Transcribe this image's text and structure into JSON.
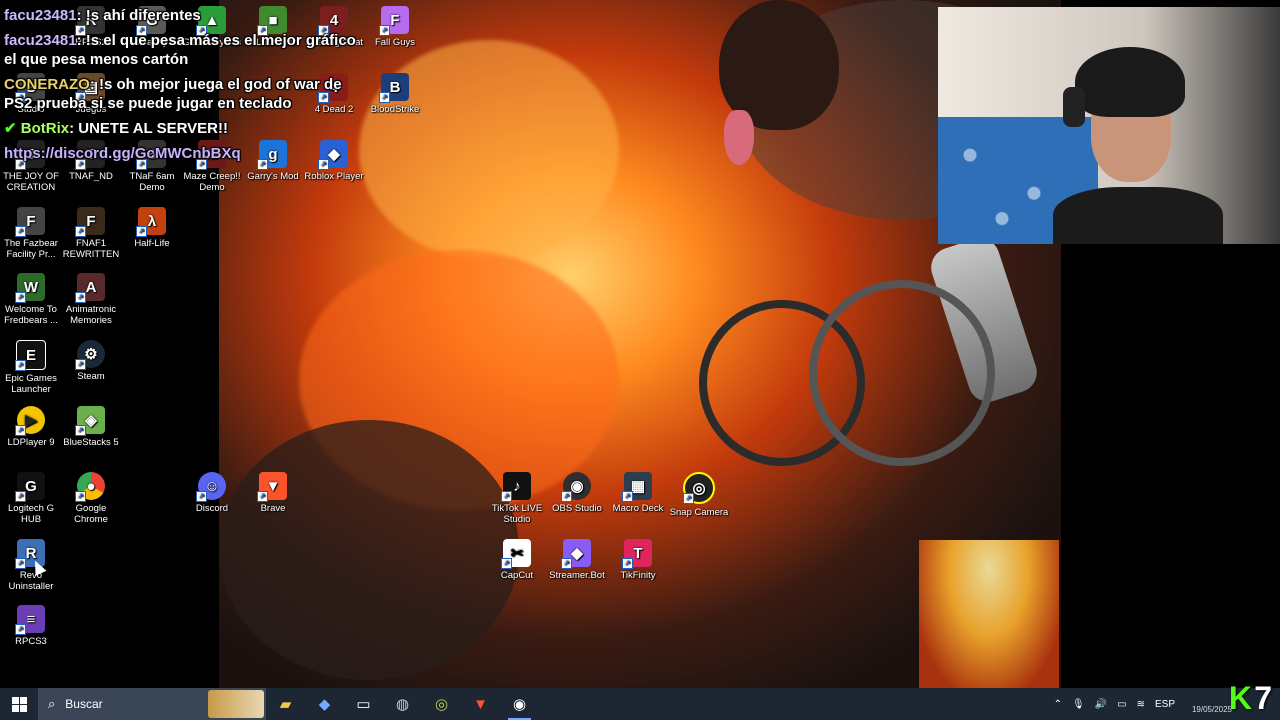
{
  "chat": [
    {
      "user": "facu23481",
      "text": ": !s ahí diferentes"
    },
    {
      "user": "facu23481",
      "text": ": !s el que pesa más es el mejor gráfico el que pesa menos cartón"
    },
    {
      "user": "CONERAZO",
      "text": ": !s oh mejor juega el god of war de PS2 prueba si se puede jugar en teclado"
    },
    {
      "user": "BotRix",
      "text": ": UNETE AL SERVER!!"
    },
    {
      "link": "https://discord.gg/GcMWCnbBXq"
    }
  ],
  "icons": {
    "rpcs2": "RPCS2",
    "granny": "Granny",
    "geometry": "GeometryDas",
    "tlauncher": "TLauncher",
    "fivenights": "Five Nights at",
    "fallguys": "Fall Guys",
    "studio": "Studio",
    "juegos": "Juegos",
    "left4dead": "4 Dead 2",
    "bloodstrike": "BloodStrike",
    "joy": "THE JOY OF CREATION",
    "tnafnd": "TNAF_ND",
    "tnaf6am": "TNaF 6am Demo",
    "mazecreep": "Maze Creep!! Demo",
    "garrys": "Garry's Mod",
    "roblox": "Roblox Player",
    "fazbear": "The Fazbear Facility Pr...",
    "fnaf1": "FNAF1 REWRITTEN",
    "halflife": "Half-Life",
    "welcome": "Welcome To Fredbears ...",
    "animatronic": "Animatronic Memories",
    "epic": "Epic Games Launcher",
    "steam": "Steam",
    "ldplayer": "LDPlayer 9",
    "bluestacks": "BlueStacks 5",
    "logitech": "Logitech G HUB",
    "chrome": "Google Chrome",
    "discord": "Discord",
    "brave": "Brave",
    "tiktok": "TikTok LIVE Studio",
    "obs": "OBS Studio",
    "macrodeck": "Macro Deck",
    "snapcam": "Snap Camera",
    "revo": "Revo Uninstaller",
    "capcut": "CapCut",
    "streamerbot": "Streamer.Bot",
    "tikfinity": "TikFinity",
    "rpcs3": "RPCS3"
  },
  "taskbar": {
    "search_placeholder": "Buscar",
    "lang": "ESP",
    "date": "19/05/2025",
    "kick": "K",
    "seven": "7"
  }
}
